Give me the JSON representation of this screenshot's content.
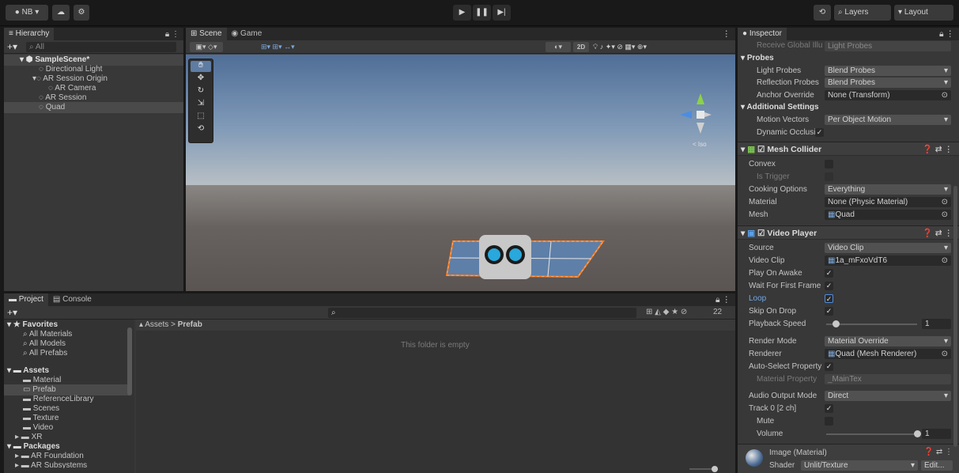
{
  "toolbar": {
    "account": "NB ▾",
    "layers": "Layers",
    "layout": "Layout"
  },
  "hierarchy": {
    "tab": "Hierarchy",
    "search_placeholder": "All",
    "items": [
      "SampleScene*",
      "Directional Light",
      "AR Session Origin",
      "AR Camera",
      "AR Session",
      "Quad"
    ]
  },
  "scene": {
    "tab_scene": "Scene",
    "tab_game": "Game",
    "mode_2d": "2D"
  },
  "project": {
    "tab_project": "Project",
    "tab_console": "Console",
    "breadcrumb_root": "Assets",
    "breadcrumb_sep": ">",
    "breadcrumb_leaf": "Prefab",
    "empty_msg": "This folder is empty",
    "hidden_count": "22",
    "favorites_label": "Favorites",
    "favorites": [
      "All Materials",
      "All Models",
      "All Prefabs"
    ],
    "assets_label": "Assets",
    "assets": [
      "Material",
      "Prefab",
      "ReferenceLibrary",
      "Scenes",
      "Texture",
      "Video",
      "XR"
    ],
    "packages_label": "Packages",
    "packages": [
      "AR Foundation",
      "AR Subsystems"
    ]
  },
  "inspector": {
    "tab": "Inspector",
    "receive_gi_label": "Receive Global Illu",
    "receive_gi_value": "Light Probes",
    "probes_label": "Probes",
    "light_probes_label": "Light Probes",
    "light_probes_value": "Blend Probes",
    "reflection_probes_label": "Reflection Probes",
    "reflection_probes_value": "Blend Probes",
    "anchor_override_label": "Anchor Override",
    "anchor_override_value": "None (Transform)",
    "additional_settings_label": "Additional Settings",
    "motion_vectors_label": "Motion Vectors",
    "motion_vectors_value": "Per Object Motion",
    "dynamic_occlusion_label": "Dynamic Occlusioi",
    "mesh_collider_title": "Mesh Collider",
    "convex_label": "Convex",
    "is_trigger_label": "Is Trigger",
    "cooking_options_label": "Cooking Options",
    "cooking_options_value": "Everything",
    "material_label": "Material",
    "material_value": "None (Physic Material)",
    "mesh_label": "Mesh",
    "mesh_value": "Quad",
    "video_player_title": "Video Player",
    "source_label": "Source",
    "source_value": "Video Clip",
    "video_clip_label": "Video Clip",
    "video_clip_value": "1a_mFxoVdT6",
    "play_on_awake_label": "Play On Awake",
    "wait_first_frame_label": "Wait For First Frame",
    "loop_label": "Loop",
    "skip_on_drop_label": "Skip On Drop",
    "playback_speed_label": "Playback Speed",
    "playback_speed_value": "1",
    "playback_speed_fraction": 0.1,
    "render_mode_label": "Render Mode",
    "render_mode_value": "Material Override",
    "renderer_label": "Renderer",
    "renderer_value": "Quad (Mesh Renderer)",
    "auto_select_label": "Auto-Select Property",
    "material_property_label": "Material Property",
    "material_property_value": "_MainTex",
    "audio_output_label": "Audio Output Mode",
    "audio_output_value": "Direct",
    "track_label": "Track 0 [2 ch]",
    "mute_label": "Mute",
    "volume_label": "Volume",
    "volume_value": "1",
    "volume_fraction": 1.0,
    "image_material_title": "Image (Material)",
    "shader_label": "Shader",
    "shader_value": "Unlit/Texture",
    "edit_label": "Edit..."
  }
}
